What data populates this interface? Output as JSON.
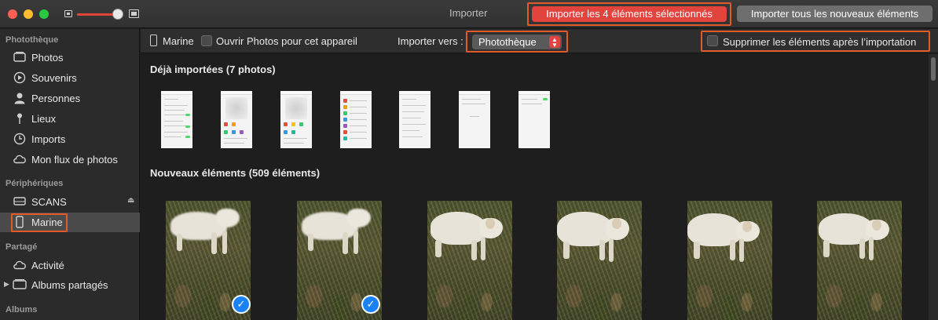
{
  "window": {
    "title": "Importer"
  },
  "titlebar": {
    "import_selected_label": "Importer les 4 éléments sélectionnés",
    "import_all_label": "Importer tous les nouveaux éléments",
    "zoom_level": 0.9
  },
  "sidebar": {
    "sections": [
      {
        "title": "Photothèque",
        "items": [
          {
            "label": "Photos",
            "icon": "photos-icon"
          },
          {
            "label": "Souvenirs",
            "icon": "memories-icon"
          },
          {
            "label": "Personnes",
            "icon": "person-icon"
          },
          {
            "label": "Lieux",
            "icon": "pin-icon"
          },
          {
            "label": "Imports",
            "icon": "clock-icon"
          },
          {
            "label": "Mon flux de photos",
            "icon": "cloud-icon"
          }
        ]
      },
      {
        "title": "Périphériques",
        "items": [
          {
            "label": "SCANS",
            "icon": "drive-icon"
          },
          {
            "label": "Marine",
            "icon": "iphone-icon",
            "selected": true
          }
        ]
      },
      {
        "title": "Partagé",
        "items": [
          {
            "label": "Activité",
            "icon": "cloud-icon"
          },
          {
            "label": "Albums partagés",
            "icon": "shared-albums-icon"
          }
        ]
      },
      {
        "title": "Albums",
        "items": []
      }
    ]
  },
  "toolbar": {
    "device_name": "Marine",
    "open_photos_label": "Ouvrir Photos pour cet appareil",
    "import_to_label": "Importer vers :",
    "import_to_value": "Photothèque",
    "delete_after_label": "Supprimer les éléments après l’importation"
  },
  "content": {
    "already_imported_heading": "Déjà importées (7 photos)",
    "new_items_heading": "Nouveaux éléments (509 éléments)",
    "new_items": [
      {
        "selected": true
      },
      {
        "selected": true
      },
      {
        "selected": false
      },
      {
        "selected": false
      },
      {
        "selected": false
      },
      {
        "selected": false
      }
    ]
  },
  "colors": {
    "accent": "#e2433d",
    "highlight_box": "#e15a2b",
    "selection_check": "#1a82f7"
  }
}
